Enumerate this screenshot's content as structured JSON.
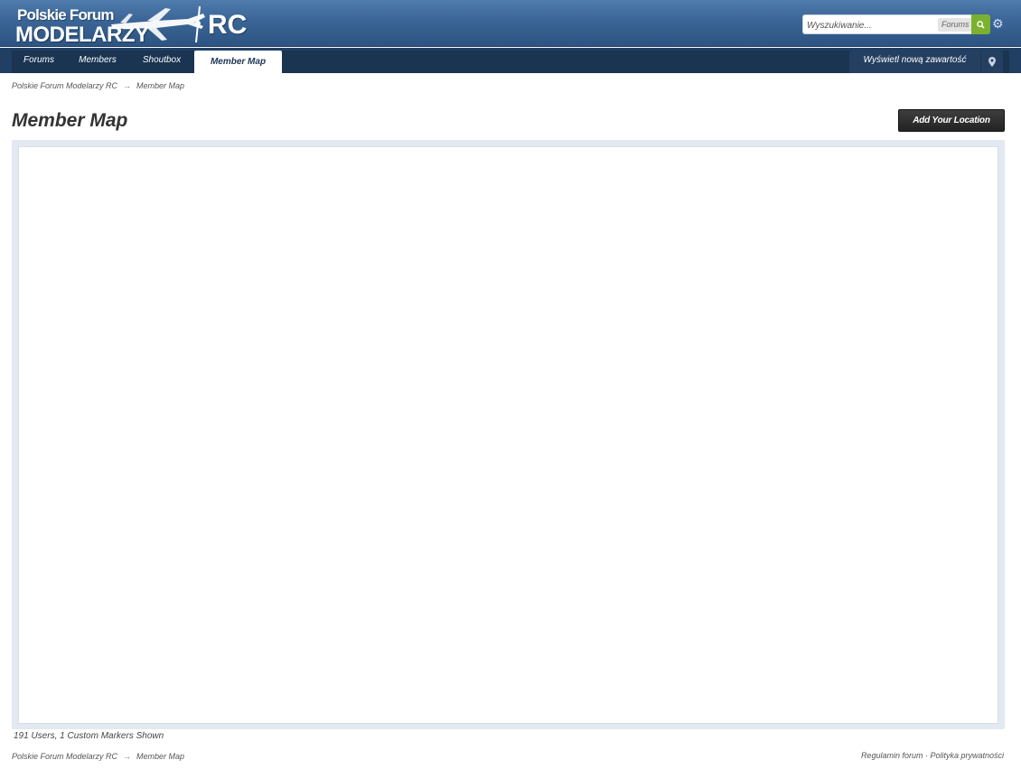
{
  "header": {
    "logo_line1": "Polskie Forum",
    "logo_line2": "MODELARZY",
    "logo_rc": "RC",
    "search": {
      "placeholder": "Wyszukiwanie...",
      "scope_label": "Forums"
    }
  },
  "nav": {
    "tabs": [
      {
        "label": "Forums"
      },
      {
        "label": "Members"
      },
      {
        "label": "Shoutbox"
      },
      {
        "label": "Member Map"
      }
    ],
    "active_tab": "Member Map",
    "right_link": "Wyświetl nową zawartość"
  },
  "breadcrumb": {
    "items": [
      "Polskie Forum Modelarzy RC",
      "Member Map"
    ],
    "separator": "→"
  },
  "page": {
    "title": "Member Map",
    "add_location_label": "Add Your Location",
    "status": "191 Users, 1 Custom Markers Shown"
  },
  "footer": {
    "breadcrumb": [
      "Polskie Forum Modelarzy RC",
      "Member Map"
    ],
    "links": "Regulamin forum · Polityka prywatności"
  },
  "colors": {
    "header": "#3a6596",
    "nav": "#1a3452",
    "search_button": "#7bb12e",
    "map_frame": "#e3e9f0"
  }
}
